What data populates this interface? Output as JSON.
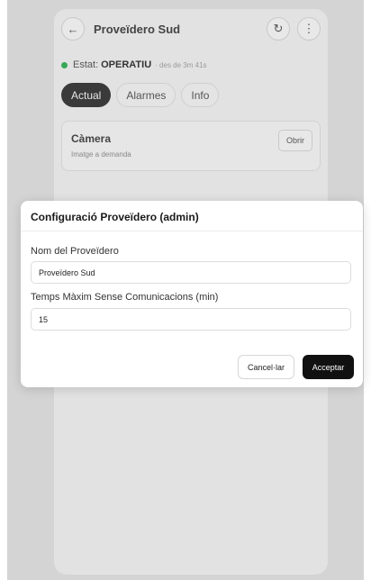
{
  "background_app": {
    "header": {
      "back_icon": "arrow-left-icon",
      "title": "Proveïdero Sud",
      "refresh_icon": "refresh-icon",
      "more_icon": "more-vertical-icon"
    },
    "status": {
      "label": "Estat:",
      "value": "OPERATIU",
      "since": "· des de 3m 41s",
      "color": "#37a855"
    },
    "tabs": [
      {
        "label": "Actual",
        "active": true
      },
      {
        "label": "Alarmes",
        "active": false
      },
      {
        "label": "Info",
        "active": false
      }
    ],
    "camera_card": {
      "title": "Càmera",
      "subtitle": "Imatge a demanda",
      "button": "Obrir"
    }
  },
  "modal": {
    "title": "Configuració Proveïdero (admin)",
    "fields": [
      {
        "label": "Nom del Proveïdero",
        "value": "Proveïdero Sud"
      },
      {
        "label": "Temps Màxim Sense Comunicacions (min)",
        "value": "15"
      }
    ],
    "cancel_label": "Cancel·lar",
    "accept_label": "Acceptar"
  }
}
